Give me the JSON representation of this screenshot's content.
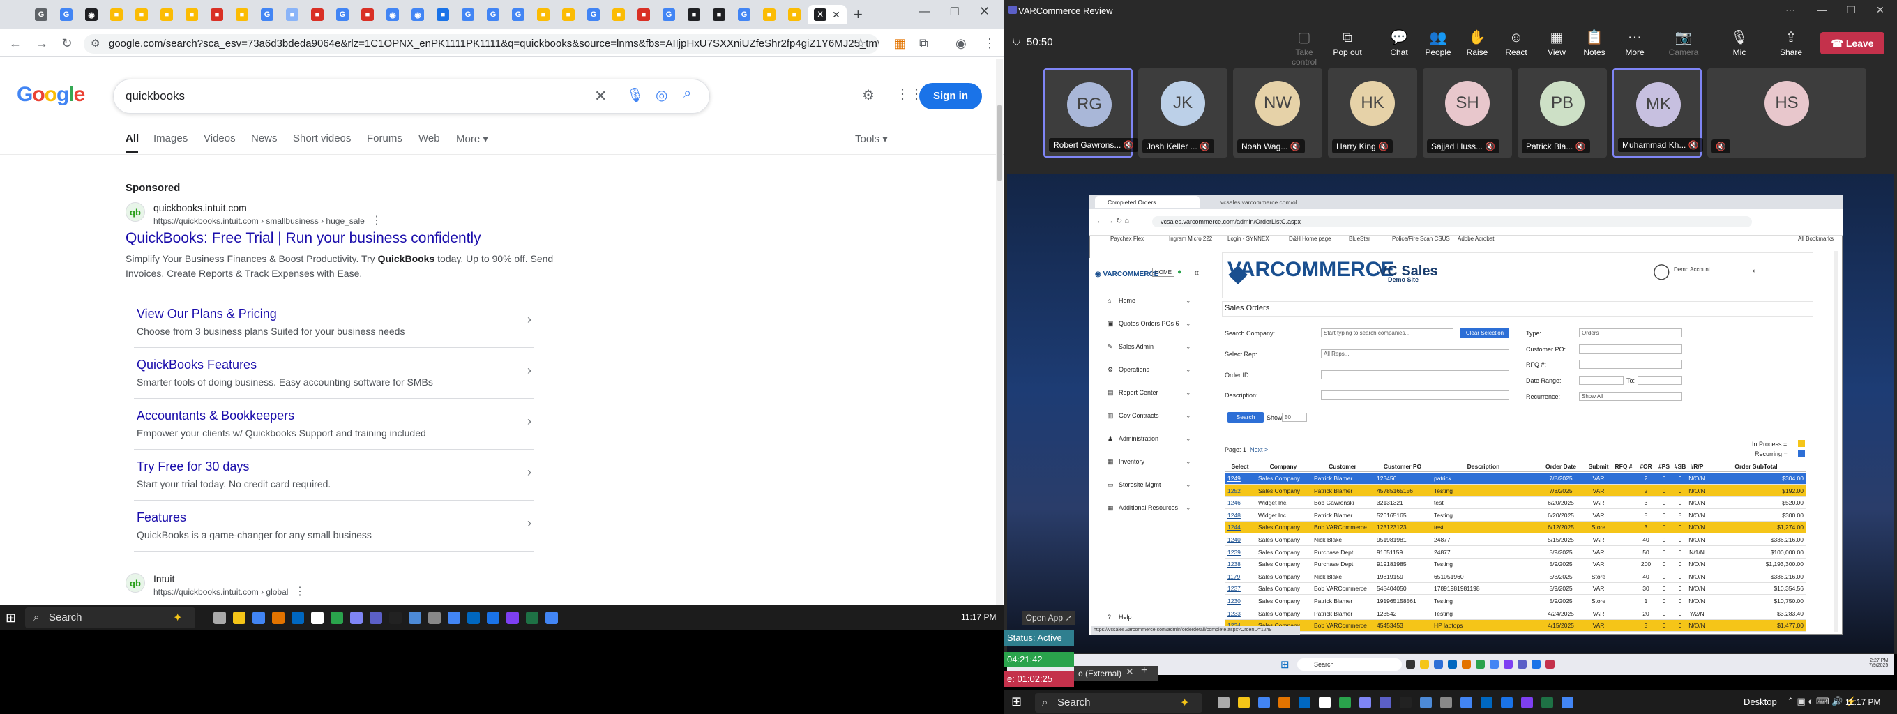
{
  "chrome": {
    "tab_letters": [
      "G",
      "G",
      "◉",
      "■",
      "■",
      "■",
      "■",
      "■",
      "■",
      "G",
      "■",
      "■",
      "G",
      "■",
      "◉",
      "◉",
      "■",
      "G",
      "G",
      "G",
      "■",
      "■",
      "G",
      "■",
      "■",
      "G",
      "■",
      "■",
      "G",
      "■",
      "■",
      "X"
    ],
    "tab_colors": [
      "#5f6368",
      "#4285f4",
      "#202124",
      "#fbbc05",
      "#fbbc05",
      "#fbbc05",
      "#fbbc05",
      "#d93025",
      "#fbbc05",
      "#4285f4",
      "#8ab4f8",
      "#d93025",
      "#4285f4",
      "#d93025",
      "#4285f4",
      "#4285f4",
      "#1a73e8",
      "#4285f4",
      "#4285f4",
      "#4285f4",
      "#fbbc05",
      "#fbbc05",
      "#4285f4",
      "#fbbc05",
      "#d93025",
      "#4285f4",
      "#202124",
      "#202124",
      "#4285f4",
      "#fbbc05",
      "#fbbc05",
      "#202124"
    ],
    "url": "google.com/search?sca_esv=73a6d3bdeda9064e&rlz=1C1OPNX_enPK1111PK1111&q=quickbooks&source=lnms&fbs=AIIjpHxU7SXXniUZfeShr2fp4giZ1Y6MJ25_tmWITc7..."
  },
  "google": {
    "logo": "Google",
    "query": "quickbooks",
    "sign_in": "Sign in",
    "tabs": [
      "All",
      "Images",
      "Videos",
      "News",
      "Short videos",
      "Forums",
      "Web",
      "More"
    ],
    "tools": "Tools",
    "sponsored": "Sponsored",
    "ad": {
      "site": "quickbooks.intuit.com",
      "url": "https://quickbooks.intuit.com › smallbusiness › huge_sale",
      "title": "QuickBooks: Free Trial | Run your business confidently",
      "desc1": "Simplify Your Business Finances & Boost Productivity. Try QuickBooks today. Up to 90% off. Send",
      "desc2": "Invoices, Create Reports & Track Expenses with Ease."
    },
    "sitelinks": [
      {
        "title": "View Our Plans & Pricing",
        "desc": "Choose from 3 business plans Suited for your business needs"
      },
      {
        "title": "QuickBooks Features",
        "desc": "Smarter tools of doing business. Easy accounting software for SMBs"
      },
      {
        "title": "Accountants & Bookkeepers",
        "desc": "Empower your clients w/ Quickbooks Support and training included"
      },
      {
        "title": "Try Free for 30 days",
        "desc": "Start your trial today. No credit card required."
      },
      {
        "title": "Features",
        "desc": "QuickBooks is a game-changer for any small business"
      }
    ],
    "organic": {
      "site": "Intuit",
      "url": "https://quickbooks.intuit.com › global"
    }
  },
  "taskbar_left": {
    "search": "Search",
    "clock": "11:17 PM"
  },
  "teams": {
    "title": "VARCommerce Review",
    "timer": "50:50",
    "toolbar": [
      {
        "icon": "▢",
        "label": "Take control",
        "disabled": true
      },
      {
        "icon": "⧉",
        "label": "Pop out"
      },
      {
        "icon": "💬",
        "label": "Chat"
      },
      {
        "icon": "👥",
        "label": "People"
      },
      {
        "icon": "✋",
        "label": "Raise"
      },
      {
        "icon": "☺",
        "label": "React"
      },
      {
        "icon": "▦",
        "label": "View"
      },
      {
        "icon": "📋",
        "label": "Notes"
      },
      {
        "icon": "⋯",
        "label": "More"
      },
      {
        "icon": "📷",
        "label": "Camera",
        "disabled": true
      },
      {
        "icon": "🎙",
        "label": "Mic"
      },
      {
        "icon": "⇪",
        "label": "Share"
      }
    ],
    "leave": "Leave",
    "participants": [
      {
        "initials": "RG",
        "name": "Robert Gawrons...",
        "hl": true,
        "color": "#a9b7d8"
      },
      {
        "initials": "JK",
        "name": "Josh Keller ...",
        "hl": false,
        "color": "#bcd0e8"
      },
      {
        "initials": "NW",
        "name": "Noah Wag...",
        "hl": false,
        "color": "#e6d2a8"
      },
      {
        "initials": "HK",
        "name": "Harry King",
        "hl": false,
        "color": "#e6d2a8"
      },
      {
        "initials": "SH",
        "name": "Sajjad Huss...",
        "hl": false,
        "color": "#e8c7cc"
      },
      {
        "initials": "PB",
        "name": "Patrick Bla...",
        "hl": false,
        "color": "#cde0c6"
      },
      {
        "initials": "MK",
        "name": "Muhammad Kh...",
        "hl": true,
        "color": "#c7c0e0"
      },
      {
        "initials": "HS",
        "name": "",
        "hl": false,
        "color": "#e8c7cc"
      }
    ]
  },
  "shared": {
    "tab1": "Completed Orders",
    "tab2": "vcsales.varcommerce.com/ol...",
    "url": "vcsales.varcommerce.com/admin/OrderListC.aspx",
    "bookmarks": [
      "Paychex Flex",
      "Ingram Micro 222",
      "Login - SYNNEX",
      "D&H Home page",
      "BlueStar",
      "Police/Fire Scan CSUS",
      "Adobe Acrobat",
      "All Bookmarks"
    ],
    "nav": [
      "Home",
      "Quotes Orders POs",
      "Sales Admin",
      "Operations",
      "Report Center",
      "Gov Contracts",
      "Administration",
      "Inventory",
      "Storesite Mgmt",
      "Additional Resources",
      "Help"
    ],
    "nav_badge": "6",
    "home_btn": "HOME",
    "logo": "VARCOMMERCE",
    "logo_sub": "VC Sales",
    "logo_sub2": "Demo Site",
    "account": "Demo Account",
    "section": "Sales Orders",
    "form": {
      "search_company": "Search Company:",
      "search_company_ph": "Start typing to search companies...",
      "clear": "Clear Selection",
      "select_rep": "Select Rep:",
      "rep_value": "All Reps...",
      "order_id": "Order ID:",
      "description": "Description:",
      "type": "Type:",
      "type_value": "Orders",
      "customer_po": "Customer PO:",
      "rfq": "RFQ #:",
      "date_range": "Date Range:",
      "to": "To:",
      "recurrence": "Recurrence:",
      "recurrence_value": "Show All",
      "search_btn": "Search",
      "show": "Show",
      "show_value": "50"
    },
    "page": "Page: 1",
    "next": "Next >",
    "legend": [
      "In Process =",
      "Recurring ="
    ],
    "columns": [
      "Select",
      "Company",
      "Customer",
      "Customer PO",
      "Description",
      "Order Date",
      "Submit",
      "RFQ #",
      "#OR",
      "#PS",
      "#SB",
      "I/R/P",
      "Order SubTotal"
    ],
    "rows": [
      [
        "1249",
        "Sales Company",
        "Patrick Blamer",
        "123456",
        "patrick",
        "7/8/2025",
        "VAR",
        "",
        "2",
        "0",
        "0",
        "N/O/N",
        "$304.00"
      ],
      [
        "1252",
        "Sales Company",
        "Patrick Blamer",
        "45785165156",
        "Testing",
        "7/8/2025",
        "VAR",
        "",
        "2",
        "0",
        "0",
        "N/O/N",
        "$192.00"
      ],
      [
        "1246",
        "Widget Inc.",
        "Bob Gawronski",
        "32131321",
        "test",
        "6/20/2025",
        "VAR",
        "",
        "3",
        "0",
        "0",
        "N/O/N",
        "$520.00"
      ],
      [
        "1248",
        "Widget Inc.",
        "Patrick Blamer",
        "526165165",
        "Testing",
        "6/20/2025",
        "VAR",
        "",
        "5",
        "0",
        "5",
        "N/O/N",
        "$300.00"
      ],
      [
        "1244",
        "Sales Company",
        "Bob VARCommerce",
        "123123123",
        "test",
        "6/12/2025",
        "Store",
        "",
        "3",
        "0",
        "0",
        "N/O/N",
        "$1,274.00"
      ],
      [
        "1240",
        "Sales Company",
        "Nick Blake",
        "951981981",
        "24877",
        "5/15/2025",
        "VAR",
        "",
        "40",
        "0",
        "0",
        "N/O/N",
        "$336,216.00"
      ],
      [
        "1239",
        "Sales Company",
        "Purchase Dept",
        "91651159",
        "24877",
        "5/9/2025",
        "VAR",
        "",
        "50",
        "0",
        "0",
        "N/1/N",
        "$100,000.00"
      ],
      [
        "1238",
        "Sales Company",
        "Purchase Dept",
        "919181985",
        "Testing",
        "5/9/2025",
        "VAR",
        "",
        "200",
        "0",
        "0",
        "N/O/N",
        "$1,193,300.00"
      ],
      [
        "1179",
        "Sales Company",
        "Nick Blake",
        "19819159",
        "651051960",
        "5/8/2025",
        "Store",
        "",
        "40",
        "0",
        "0",
        "N/O/N",
        "$336,216.00"
      ],
      [
        "1237",
        "Sales Company",
        "Bob VARCommerce",
        "545404050",
        "17891981981198",
        "5/9/2025",
        "VAR",
        "",
        "30",
        "0",
        "0",
        "N/O/N",
        "$10,354.56"
      ],
      [
        "1230",
        "Sales Company",
        "Patrick Blamer",
        "191965158561",
        "Testing",
        "5/9/2025",
        "Store",
        "",
        "1",
        "0",
        "0",
        "N/O/N",
        "$10,750.00"
      ],
      [
        "1233",
        "Sales Company",
        "Patrick Blamer",
        "123542",
        "Testing",
        "4/24/2025",
        "VAR",
        "",
        "20",
        "0",
        "0",
        "Y/2/N",
        "$3,283.40"
      ],
      [
        "1234",
        "Sales Company",
        "Bob VARCommerce",
        "45453453",
        "HP laptops",
        "4/15/2025",
        "VAR",
        "",
        "3",
        "0",
        "0",
        "N/O/N",
        "$1,477.00"
      ]
    ],
    "row_colors": [
      "#2d6fd6",
      "#f5c518",
      "#ffffff",
      "#ffffff",
      "#f5c518",
      "#ffffff",
      "#ffffff",
      "#ffffff",
      "#ffffff",
      "#ffffff",
      "#ffffff",
      "#ffffff",
      "#f5c518"
    ],
    "statusbar": "https://vcsales.varcommerce.com/admin/orderdetail/complete.aspx?OrderID=1249",
    "taskbar_search": "Search",
    "taskbar_time": "2:27 PM",
    "taskbar_date": "7/9/2025"
  },
  "overlay": {
    "open_app": "Open App ↗",
    "status": "Status: Active",
    "time1": "04:21:42",
    "time2": "e: 01:02:25",
    "external": "o (External)"
  },
  "taskbar_right": {
    "search": "Search",
    "desktop": "Desktop",
    "clock": "11:17 PM"
  }
}
